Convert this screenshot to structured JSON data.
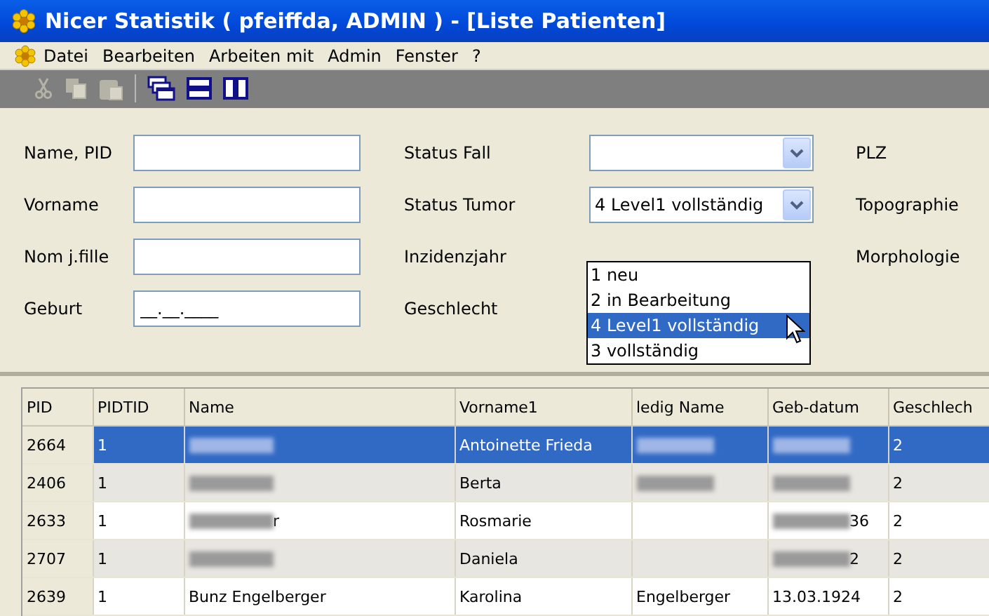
{
  "window": {
    "title": "Nicer Statistik ( pfeiffda, ADMIN ) - [Liste Patienten]"
  },
  "menu": [
    "Datei",
    "Bearbeiten",
    "Arbeiten mit",
    "Admin",
    "Fenster",
    "?"
  ],
  "toolbar": [
    {
      "kind": "cut",
      "disabled": true
    },
    {
      "kind": "copy",
      "disabled": true
    },
    {
      "kind": "paste",
      "disabled": true
    },
    {
      "kind": "separator",
      "disabled": false
    },
    {
      "kind": "cascade",
      "disabled": false
    },
    {
      "kind": "tile-h",
      "disabled": false
    },
    {
      "kind": "tile-v",
      "disabled": false
    }
  ],
  "form": {
    "fields": [
      {
        "label": "Name, PID"
      },
      {
        "label": "Vorname"
      },
      {
        "label": "Nom j.fille"
      },
      {
        "label": "Geburt",
        "value": "__.__.____"
      }
    ],
    "middle": [
      {
        "label": "Status Fall",
        "kind": "combo"
      },
      {
        "label": "Status Tumor",
        "kind": "combo",
        "value": "4 Level1 vollständig"
      },
      {
        "label": "Inzidenzjahr",
        "kind": "none"
      },
      {
        "label": "Geschlecht",
        "kind": "none"
      }
    ],
    "right": [
      "PLZ",
      "Topographie",
      "Morphologie"
    ],
    "dropdown": [
      {
        "label": "1 neu",
        "selected": false
      },
      {
        "label": "2 in Bearbeitung",
        "selected": false
      },
      {
        "label": "4 Level1 vollständig",
        "selected": true
      },
      {
        "label": "3 vollständig",
        "selected": false
      }
    ]
  },
  "table": {
    "columns": [
      "PID",
      "PIDTID",
      "Name",
      "Vorname1",
      "ledig Name",
      "Geb-datum",
      "Geschlech"
    ],
    "rows": [
      {
        "selected": true,
        "cells": [
          {
            "text": "2664"
          },
          {
            "text": "1"
          },
          {
            "redacted": true
          },
          {
            "text": "Antoinette Frieda"
          },
          {
            "redacted": true
          },
          {
            "redacted": true
          },
          {
            "text": "2"
          }
        ]
      },
      {
        "selected": false,
        "cells": [
          {
            "text": "2406"
          },
          {
            "text": "1"
          },
          {
            "redacted": true
          },
          {
            "text": "Berta"
          },
          {
            "redacted": true
          },
          {
            "redacted": true
          },
          {
            "text": "2"
          }
        ]
      },
      {
        "selected": false,
        "cells": [
          {
            "text": "2633"
          },
          {
            "text": "1"
          },
          {
            "redacted": true,
            "suffix": "r"
          },
          {
            "text": "Rosmarie"
          },
          {},
          {
            "redacted": true,
            "suffix": "36"
          },
          {
            "text": "2"
          }
        ]
      },
      {
        "selected": false,
        "cells": [
          {
            "text": "2707"
          },
          {
            "text": "1"
          },
          {
            "redacted": true
          },
          {
            "text": "Daniela"
          },
          {},
          {
            "redacted": true,
            "suffix": "2"
          },
          {
            "text": "2"
          }
        ]
      },
      {
        "selected": false,
        "cells": [
          {
            "text": "2639"
          },
          {
            "text": "1"
          },
          {
            "text": "Bunz Engelberger"
          },
          {
            "text": "Karolina"
          },
          {
            "text": "Engelberger"
          },
          {
            "text": "13.03.1924"
          },
          {
            "text": "2"
          }
        ]
      }
    ]
  }
}
